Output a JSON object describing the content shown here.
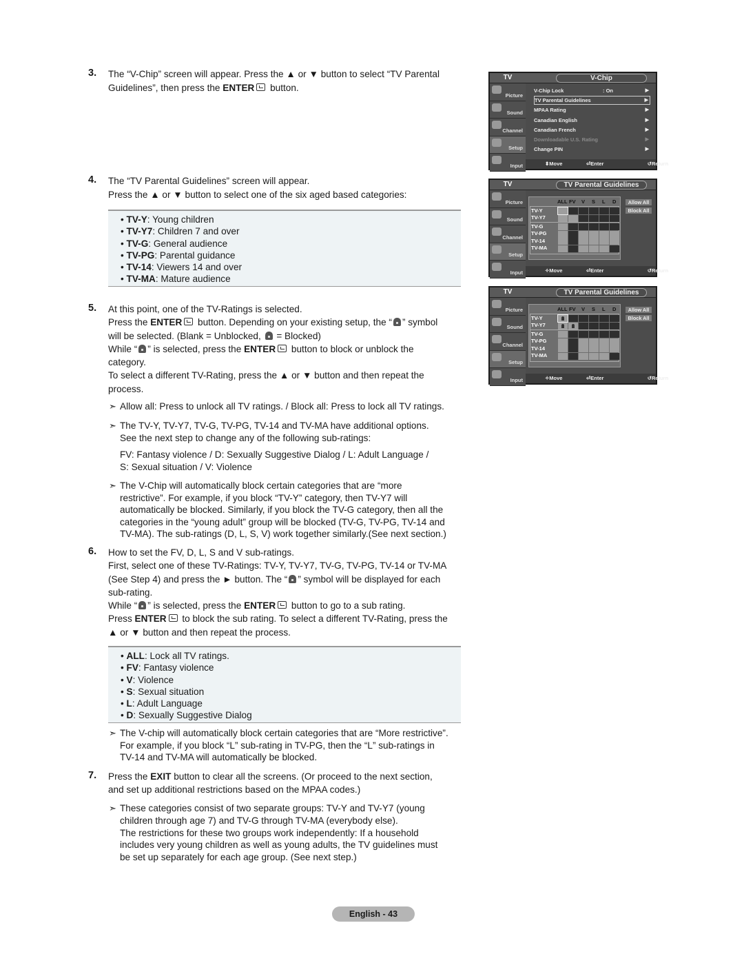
{
  "steps": {
    "s3": {
      "num": "3.",
      "t1": "The “V-Chip” screen will appear. Press the ▲ or ▼ button to select “TV Parental",
      "t2a": "Guidelines”, then press the ",
      "t2b": "ENTER",
      "t2c": " button."
    },
    "s4": {
      "num": "4.",
      "t1": "The “TV Parental Guidelines” screen will appear.",
      "t2": "Press the ▲ or ▼ button to select one of the six aged based categories:"
    },
    "s5": {
      "num": "5.",
      "t1": "At this point, one of the TV-Ratings is selected.",
      "t2a": "Press the ",
      "t2b": "ENTER",
      "t2c": " button. Depending on your existing setup, the “",
      "t2d": "” symbol",
      "t3a": "will be selected. (Blank = Unblocked, ",
      "t3b": " = Blocked)",
      "t4a": "While “",
      "t4b": "” is selected, press the ",
      "t4c": "ENTER",
      "t4d": " button to block or unblock the",
      "t5": "category.",
      "t6": "To select a different TV-Rating, press the ▲ or ▼ button and then repeat the",
      "t7": "process."
    },
    "s6": {
      "num": "6.",
      "t1": "How to set the FV, D, L, S and V sub-ratings.",
      "t2": "First, select one of these TV-Ratings: TV-Y, TV-Y7, TV-G, TV-PG, TV-14 or TV-MA",
      "t3a": "(See Step 4) and press the ► button. The “",
      "t3b": "” symbol will be displayed for each",
      "t4": "sub-rating.",
      "t5a": "While “",
      "t5b": "” is selected, press the ",
      "t5c": "ENTER",
      "t5d": " button to go to a sub rating.",
      "t6a": "Press ",
      "t6b": "ENTER",
      "t6c": " to block the sub rating. To select a different TV-Rating, press the",
      "t7": "▲ or ▼ button and then repeat the process."
    },
    "s7": {
      "num": "7.",
      "t1a": "Press the ",
      "t1b": "EXIT",
      "t1c": " button to clear all the screens. (Or proceed to the next section,",
      "t2": "and set up additional restrictions based on the MPAA codes.)"
    }
  },
  "categories_box": [
    {
      "code": "TV-Y",
      "desc": ": Young children"
    },
    {
      "code": "TV-Y7",
      "desc": ": Children 7 and over"
    },
    {
      "code": "TV-G",
      "desc": ": General audience"
    },
    {
      "code": "TV-PG",
      "desc": ": Parental guidance"
    },
    {
      "code": "TV-14",
      "desc": ": Viewers 14 and over"
    },
    {
      "code": "TV-MA",
      "desc": ": Mature audience"
    }
  ],
  "subratings_box": [
    {
      "code": "ALL",
      "desc": ": Lock all TV ratings."
    },
    {
      "code": "FV",
      "desc": ": Fantasy violence"
    },
    {
      "code": "V",
      "desc": ": Violence"
    },
    {
      "code": "S",
      "desc": ": Sexual situation"
    },
    {
      "code": "L",
      "desc": ": Adult Language"
    },
    {
      "code": "D",
      "desc": ": Sexually Suggestive Dialog"
    }
  ],
  "notes": {
    "arrow": "➣",
    "n1": "Allow all: Press to unlock all TV ratings. / Block all: Press to lock all TV ratings.",
    "n2": [
      "The TV-Y, TV-Y7, TV-G, TV-PG, TV-14 and TV-MA have additional options.",
      "See the next step to change any of the following sub-ratings:"
    ],
    "n2b": [
      "FV: Fantasy violence / D: Sexually Suggestive Dialog / L: Adult Language /",
      "S: Sexual situation / V: Violence"
    ],
    "n3": [
      "The V-Chip will automatically block certain categories that are “more",
      "restrictive”. For example, if you block “TV-Y” category, then TV-Y7 will",
      "automatically be blocked. Similarly, if you block the TV-G category, then all the",
      "categories in the “young adult” group will be blocked (TV-G, TV-PG, TV-14 and",
      "TV-MA). The sub-ratings (D, L, S, V) work together similarly.(See next section.)"
    ],
    "n4": [
      "The V-chip will automatically block certain categories that are “More restrictive”.",
      "For example, if you block “L” sub-rating in TV-PG, then the “L” sub-ratings in",
      "TV-14 and TV-MA will automatically be blocked."
    ],
    "n5": [
      "These categories consist of two separate groups: TV-Y and TV-Y7 (young",
      "children through age 7) and TV-G through TV-MA (everybody else).",
      "The restrictions for these two groups work independently: If a household",
      "includes very young children as well as young adults, the TV guidelines must",
      "be set up separately for each age group. (See next step.)"
    ]
  },
  "tv": {
    "mode": "TV",
    "side_items": [
      "Picture",
      "Sound",
      "Channel",
      "Setup",
      "Input"
    ],
    "active_side": "Setup",
    "footer": {
      "move": "Move",
      "enter": "Enter",
      "return": "Return"
    },
    "vchip": {
      "title": "V-Chip",
      "items": [
        {
          "label": "V-Chip Lock",
          "value": ": On",
          "selected": false,
          "disabled": false
        },
        {
          "label": "TV Parental Guidelines",
          "value": "",
          "selected": true,
          "disabled": false
        },
        {
          "label": "MPAA Rating",
          "value": "",
          "selected": false,
          "disabled": false
        },
        {
          "label": "Canadian English",
          "value": "",
          "selected": false,
          "disabled": false
        },
        {
          "label": "Canadian French",
          "value": "",
          "selected": false,
          "disabled": false
        },
        {
          "label": "Downloadable U.S. Rating",
          "value": "",
          "selected": false,
          "disabled": true
        },
        {
          "label": "Change PIN",
          "value": "",
          "selected": false,
          "disabled": false
        }
      ]
    },
    "guidelines": {
      "title": "TV Parental Guidelines",
      "columns": [
        "ALL",
        "FV",
        "V",
        "S",
        "L",
        "D"
      ],
      "rows": [
        "TV-Y",
        "TV-Y7",
        "TV-G",
        "TV-PG",
        "TV-14",
        "TV-MA"
      ],
      "allow_all": "Allow All",
      "block_all": "Block All",
      "cell_states": [
        [
          "light",
          "dark",
          "dark",
          "dark",
          "dark",
          "dark"
        ],
        [
          "light",
          "light",
          "dark",
          "dark",
          "dark",
          "dark"
        ],
        [
          "light",
          "dark",
          "dark",
          "dark",
          "dark",
          "dark"
        ],
        [
          "light",
          "dark",
          "light",
          "light",
          "light",
          "light"
        ],
        [
          "light",
          "dark",
          "light",
          "light",
          "light",
          "light"
        ],
        [
          "light",
          "dark",
          "light",
          "light",
          "light",
          "dark"
        ]
      ],
      "screen2_locks": [
        [
          0,
          0
        ],
        [
          1,
          0
        ],
        [
          1,
          1
        ]
      ]
    }
  },
  "page_label": "English - 43"
}
